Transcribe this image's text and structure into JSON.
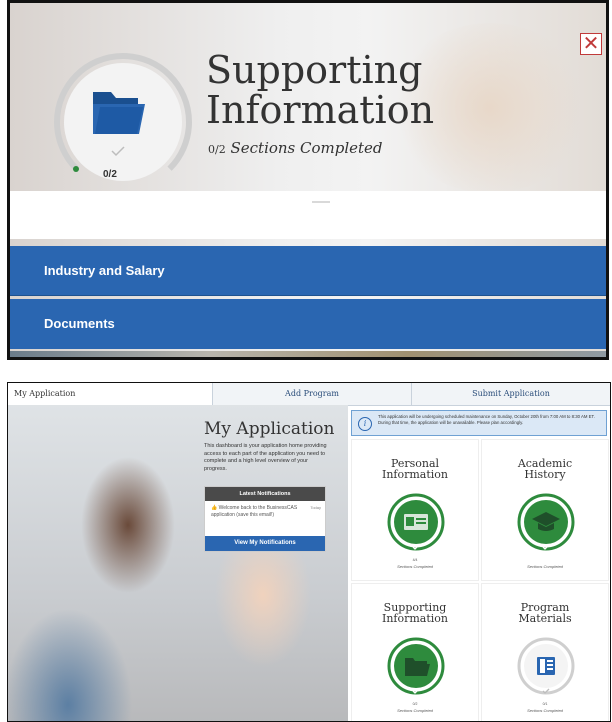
{
  "modal": {
    "title_line1": "Supporting",
    "title_line2": "Information",
    "progress_fraction": "0/2",
    "progress_text": "Sections Completed",
    "ring_count": "0/2",
    "close_symbol": "✕",
    "rows": [
      "Industry and Salary",
      "Documents"
    ],
    "accent_color": "#2a66b1",
    "ring_progress_color": "#2e8b3d"
  },
  "dashboard": {
    "tabs": [
      "My Application",
      "Add Program",
      "Submit Application"
    ],
    "title": "My Application",
    "intro": "This dashboard is your application home providing access to each part of the application you need to complete and a high level overview of your progress.",
    "notifications": {
      "header": "Latest Notifications",
      "message": "Welcome back to the BusinessCAS application (save this email!)",
      "date": "Today",
      "button": "View My Notifications"
    },
    "banner": "This application will be undergoing scheduled maintenance on Sunday, October 20th from 7:00 AM to 8:30 AM ET. During that time, the application will be unavailable. Please plan accordingly.",
    "sections": [
      {
        "name_line1": "Personal",
        "name_line2": "Information",
        "count": "4/4",
        "label": "Sections Completed",
        "icon": "id-card-icon",
        "complete": true
      },
      {
        "name_line1": "Academic",
        "name_line2": "History",
        "count": "",
        "label": "Sections Completed",
        "icon": "graduation-cap-icon",
        "complete": true
      },
      {
        "name_line1": "Supporting",
        "name_line2": "Information",
        "count": "0/2",
        "label": "Sections Completed",
        "icon": "folder-icon",
        "complete": true
      },
      {
        "name_line1": "Program",
        "name_line2": "Materials",
        "count": "0/1",
        "label": "Sections Completed",
        "icon": "book-icon",
        "complete": false
      }
    ]
  }
}
